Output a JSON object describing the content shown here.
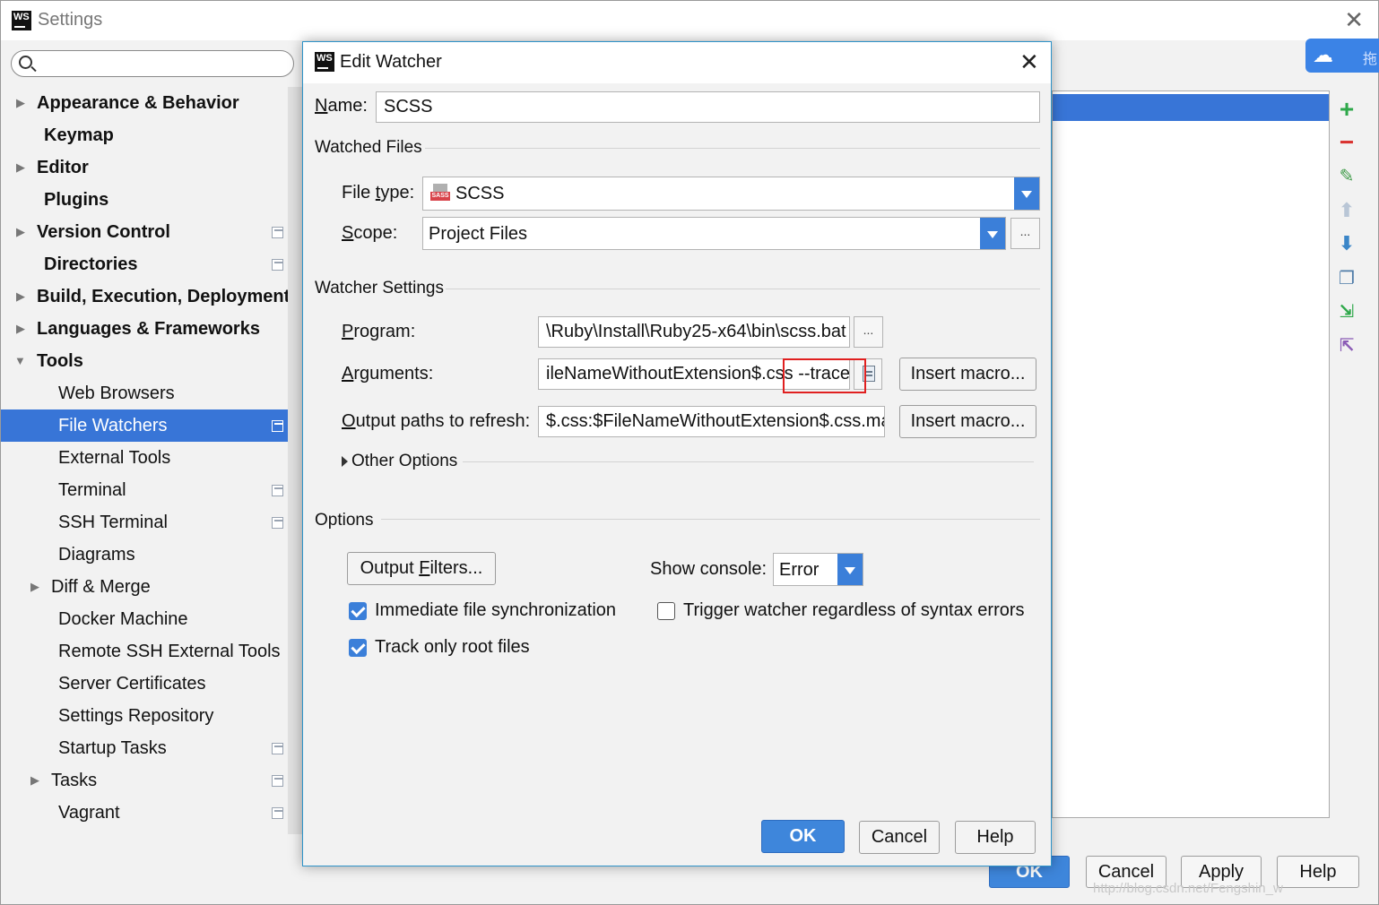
{
  "window": {
    "title": "Settings"
  },
  "search": {
    "placeholder": ""
  },
  "sidebar": {
    "items": [
      {
        "label": "Appearance & Behavior"
      },
      {
        "label": "Keymap"
      },
      {
        "label": "Editor"
      },
      {
        "label": "Plugins"
      },
      {
        "label": "Version Control"
      },
      {
        "label": "Directories"
      },
      {
        "label": "Build, Execution, Deployment"
      },
      {
        "label": "Languages & Frameworks"
      },
      {
        "label": "Tools"
      },
      {
        "label": "Web Browsers"
      },
      {
        "label": "File Watchers"
      },
      {
        "label": "External Tools"
      },
      {
        "label": "Terminal"
      },
      {
        "label": "SSH Terminal"
      },
      {
        "label": "Diagrams"
      },
      {
        "label": "Diff & Merge"
      },
      {
        "label": "Docker Machine"
      },
      {
        "label": "Remote SSH External Tools"
      },
      {
        "label": "Server Certificates"
      },
      {
        "label": "Settings Repository"
      },
      {
        "label": "Startup Tasks"
      },
      {
        "label": "Tasks"
      },
      {
        "label": "Vagrant"
      }
    ]
  },
  "cloud_badge": {
    "char": "拖"
  },
  "footer": {
    "ok": "OK",
    "cancel": "Cancel",
    "apply": "Apply",
    "help": "Help",
    "watermark": "http://blog.csdn.net/Fengshin_w"
  },
  "dialog": {
    "title": "Edit Watcher",
    "name_label_u": "N",
    "name_label_rest": "ame:",
    "name_value": "SCSS",
    "watched_files": {
      "section": "Watched Files",
      "file_type_label_a": "File ",
      "file_type_label_u": "t",
      "file_type_label_b": "ype:",
      "file_type_value": "SCSS",
      "file_type_icon_text": "SASS",
      "scope_label_u": "S",
      "scope_label_rest": "cope:",
      "scope_value": "Project Files",
      "scope_more": "..."
    },
    "watcher_settings": {
      "section": "Watcher Settings",
      "program_label_u": "P",
      "program_label_rest": "rogram:",
      "program_value": "\\Ruby\\Install\\Ruby25-x64\\bin\\scss.bat",
      "program_more": "...",
      "arguments_label_u": "A",
      "arguments_label_rest": "rguments:",
      "arguments_value": "ileNameWithoutExtension$.css --trace",
      "output_label_u": "O",
      "output_label_rest": "utput paths to refresh:",
      "output_value": "$.css:$FileNameWithoutExtension$.css.map",
      "insert_macro": "Insert macro...",
      "other_options": "Other Options"
    },
    "options": {
      "section": "Options",
      "output_filters_a": "Output ",
      "output_filters_u": "F",
      "output_filters_b": "ilters...",
      "show_console_label": "Show console:",
      "show_console_value": "Error",
      "immediate_sync": {
        "label": "Immediate file synchronization",
        "checked": true
      },
      "trigger_watcher": {
        "label": "Trigger watcher regardless of syntax errors",
        "checked": false
      },
      "track_root": {
        "label": "Track only root files",
        "checked": true
      }
    },
    "buttons": {
      "ok": "OK",
      "cancel": "Cancel",
      "help": "Help"
    }
  },
  "colors": {
    "accent": "#3875d7",
    "primary_button": "#3e86db",
    "highlight_box": "#e02020",
    "add_icon": "#2ea84a",
    "remove_icon": "#d9322f"
  },
  "icons": {
    "toolbar": [
      "add-icon",
      "remove-icon",
      "edit-icon",
      "move-up-icon",
      "move-down-icon",
      "copy-icon",
      "import-icon",
      "export-icon"
    ]
  }
}
